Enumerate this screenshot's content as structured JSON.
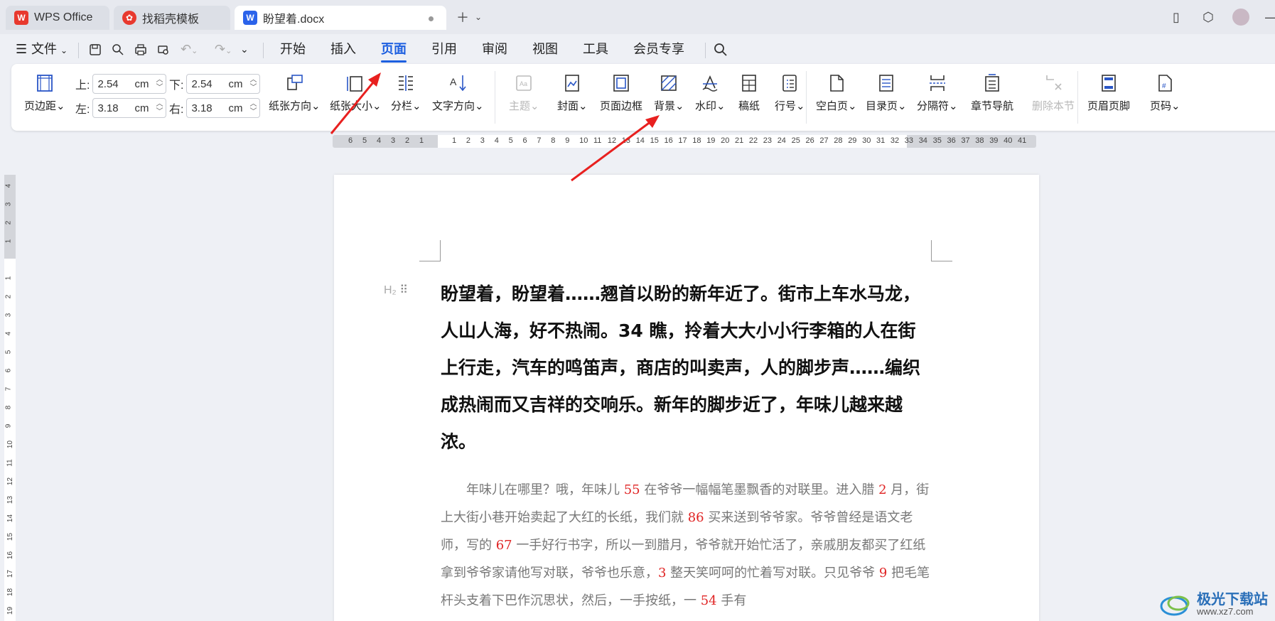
{
  "tabs": [
    {
      "label": "WPS Office",
      "active": false
    },
    {
      "label": "找稻壳模板",
      "active": false
    },
    {
      "label": "盼望着.docx",
      "active": true
    }
  ],
  "menu": {
    "file_label": "文件",
    "items": [
      "开始",
      "插入",
      "页面",
      "引用",
      "审阅",
      "视图",
      "工具",
      "会员专享"
    ],
    "active": "页面"
  },
  "margins": {
    "top_label": "上:",
    "top_value": "2.54",
    "bottom_label": "下:",
    "bottom_value": "2.54",
    "left_label": "左:",
    "left_value": "3.18",
    "right_label": "右:",
    "right_value": "3.18",
    "unit": "cm"
  },
  "ribbon": {
    "margin_btn": "页边距",
    "orientation": "纸张方向",
    "size": "纸张大小",
    "columns": "分栏",
    "text_direction": "文字方向",
    "theme": "主题",
    "cover": "封面",
    "page_border": "页面边框",
    "background": "背景",
    "watermark": "水印",
    "manuscript": "稿纸",
    "line_number": "行号",
    "blank_page": "空白页",
    "toc_page": "目录页",
    "separator": "分隔符",
    "section_nav": "章节导航",
    "delete_section": "删除本节",
    "header_footer": "页眉页脚",
    "page_number": "页码"
  },
  "ruler": {
    "h_left": [
      "6",
      "5",
      "4",
      "3",
      "2",
      "1"
    ],
    "h_right": [
      "1",
      "2",
      "3",
      "4",
      "5",
      "6",
      "7",
      "8",
      "9",
      "10",
      "11",
      "12",
      "13",
      "14",
      "15",
      "16",
      "17",
      "18",
      "19",
      "20",
      "21",
      "22",
      "23",
      "24",
      "25",
      "26",
      "27",
      "28",
      "29",
      "30",
      "31",
      "32",
      "33",
      "34",
      "35",
      "36",
      "37",
      "38",
      "39",
      "40",
      "41"
    ],
    "v_top": [
      "4",
      "3",
      "2",
      "1"
    ],
    "v_bottom": [
      "1",
      "2",
      "3",
      "4",
      "5",
      "6",
      "7",
      "8",
      "9",
      "10",
      "11",
      "12",
      "13",
      "14",
      "15",
      "16",
      "17",
      "18",
      "19"
    ]
  },
  "document": {
    "heading_marker": "H₂",
    "heading": "盼望着，盼望着……翘首以盼的新年近了。街市上车水马龙，人山人海，好不热闹。34 瞧，拎着大大小小行李箱的人在街上行走，汽车的鸣笛声，商店的叫卖声，人的脚步声……编织成热闹而又吉祥的交响乐。新年的脚步近了，年味儿越来越浓。",
    "paragraph": [
      {
        "t": "年味儿在哪里？哦，年味儿 "
      },
      {
        "n": "55"
      },
      {
        "t": " 在爷爷一幅幅笔墨飘香的对联里。进入腊 "
      },
      {
        "n": "2"
      },
      {
        "t": " 月，街上大街小巷开始卖起了大红的长纸，我们就 "
      },
      {
        "n": "86"
      },
      {
        "t": " 买来送到爷爷家。爷爷曾经是语文老师，写的 "
      },
      {
        "n": "67"
      },
      {
        "t": " 一手好行书字，所以一到腊月，爷爷就开始忙活了，亲戚朋友都买了红纸拿到爷爷家请他写对联，爷爷也乐意，"
      },
      {
        "n": "3"
      },
      {
        "t": " 整天笑呵呵的忙着写对联。只见爷爷 "
      },
      {
        "n": "9"
      },
      {
        "t": " 把毛笔杆头支着下巴作沉思状，然后，一手按纸，一 "
      },
      {
        "n": "54"
      },
      {
        "t": " 手有"
      }
    ]
  },
  "watermark": {
    "title": "极光下载站",
    "url": "www.xz7.com"
  },
  "colors": {
    "accent": "#1d5fe0",
    "number_red": "#e02424",
    "arrow_red": "#e8201f"
  }
}
